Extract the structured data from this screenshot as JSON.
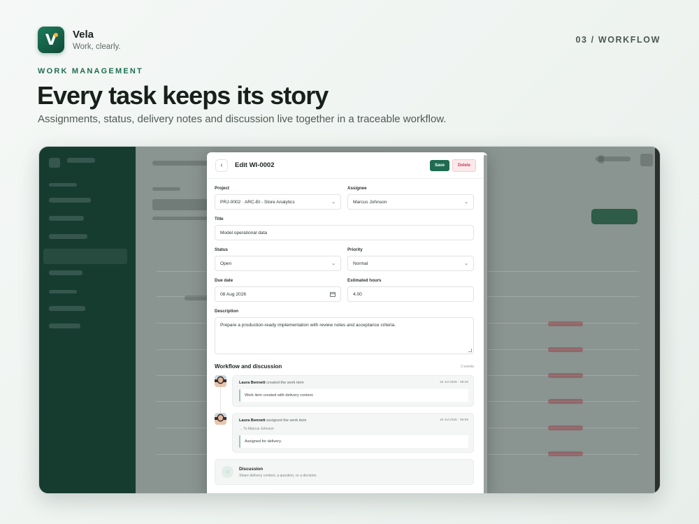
{
  "brand": {
    "name": "Vela",
    "tagline": "Work, clearly.",
    "logo_letter": "V",
    "accent": "#1e7a5c",
    "dot_color": "#f2b43c"
  },
  "section_id": "03 / WORKFLOW",
  "eyebrow": "WORK MANAGEMENT",
  "headline": "Every task keeps its story",
  "subline": "Assignments, status, delivery notes and discussion live together in a traceable workflow.",
  "modal": {
    "title": "Edit WI-0002",
    "back_icon": "chevron-left-icon",
    "save_label": "Save",
    "delete_label": "Delete",
    "fields": {
      "project": {
        "label": "Project",
        "value": "PRJ-0002 · ARC-BI - Store Analytics"
      },
      "assignee": {
        "label": "Assignee",
        "value": "Marcus Johnson"
      },
      "title": {
        "label": "Title",
        "value": "Model operational data"
      },
      "status": {
        "label": "Status",
        "value": "Open"
      },
      "priority": {
        "label": "Priority",
        "value": "Normal"
      },
      "due_date": {
        "label": "Due date",
        "value": "08 Aug 2026"
      },
      "estimated_hours": {
        "label": "Estimated hours",
        "value": "4.00"
      },
      "description": {
        "label": "Description",
        "value": "Prepare a production-ready implementation with review notes and acceptance criteria."
      }
    },
    "workflow": {
      "title": "Workflow and discussion",
      "count": "2 events",
      "events": [
        {
          "actor": "Laura Bennett",
          "action": "created the work item",
          "time": "16 Jul 2026 · 09:40",
          "note": "Work item created with delivery context."
        },
        {
          "actor": "Laura Bennett",
          "action": "assigned the work item",
          "time": "16 Jul 2026 · 09:55",
          "to": "→ To Marcus Johnson",
          "note": "Assigned for delivery."
        }
      ]
    },
    "discussion": {
      "title": "Discussion",
      "subtitle": "Share delivery context, a question, or a decision."
    }
  }
}
